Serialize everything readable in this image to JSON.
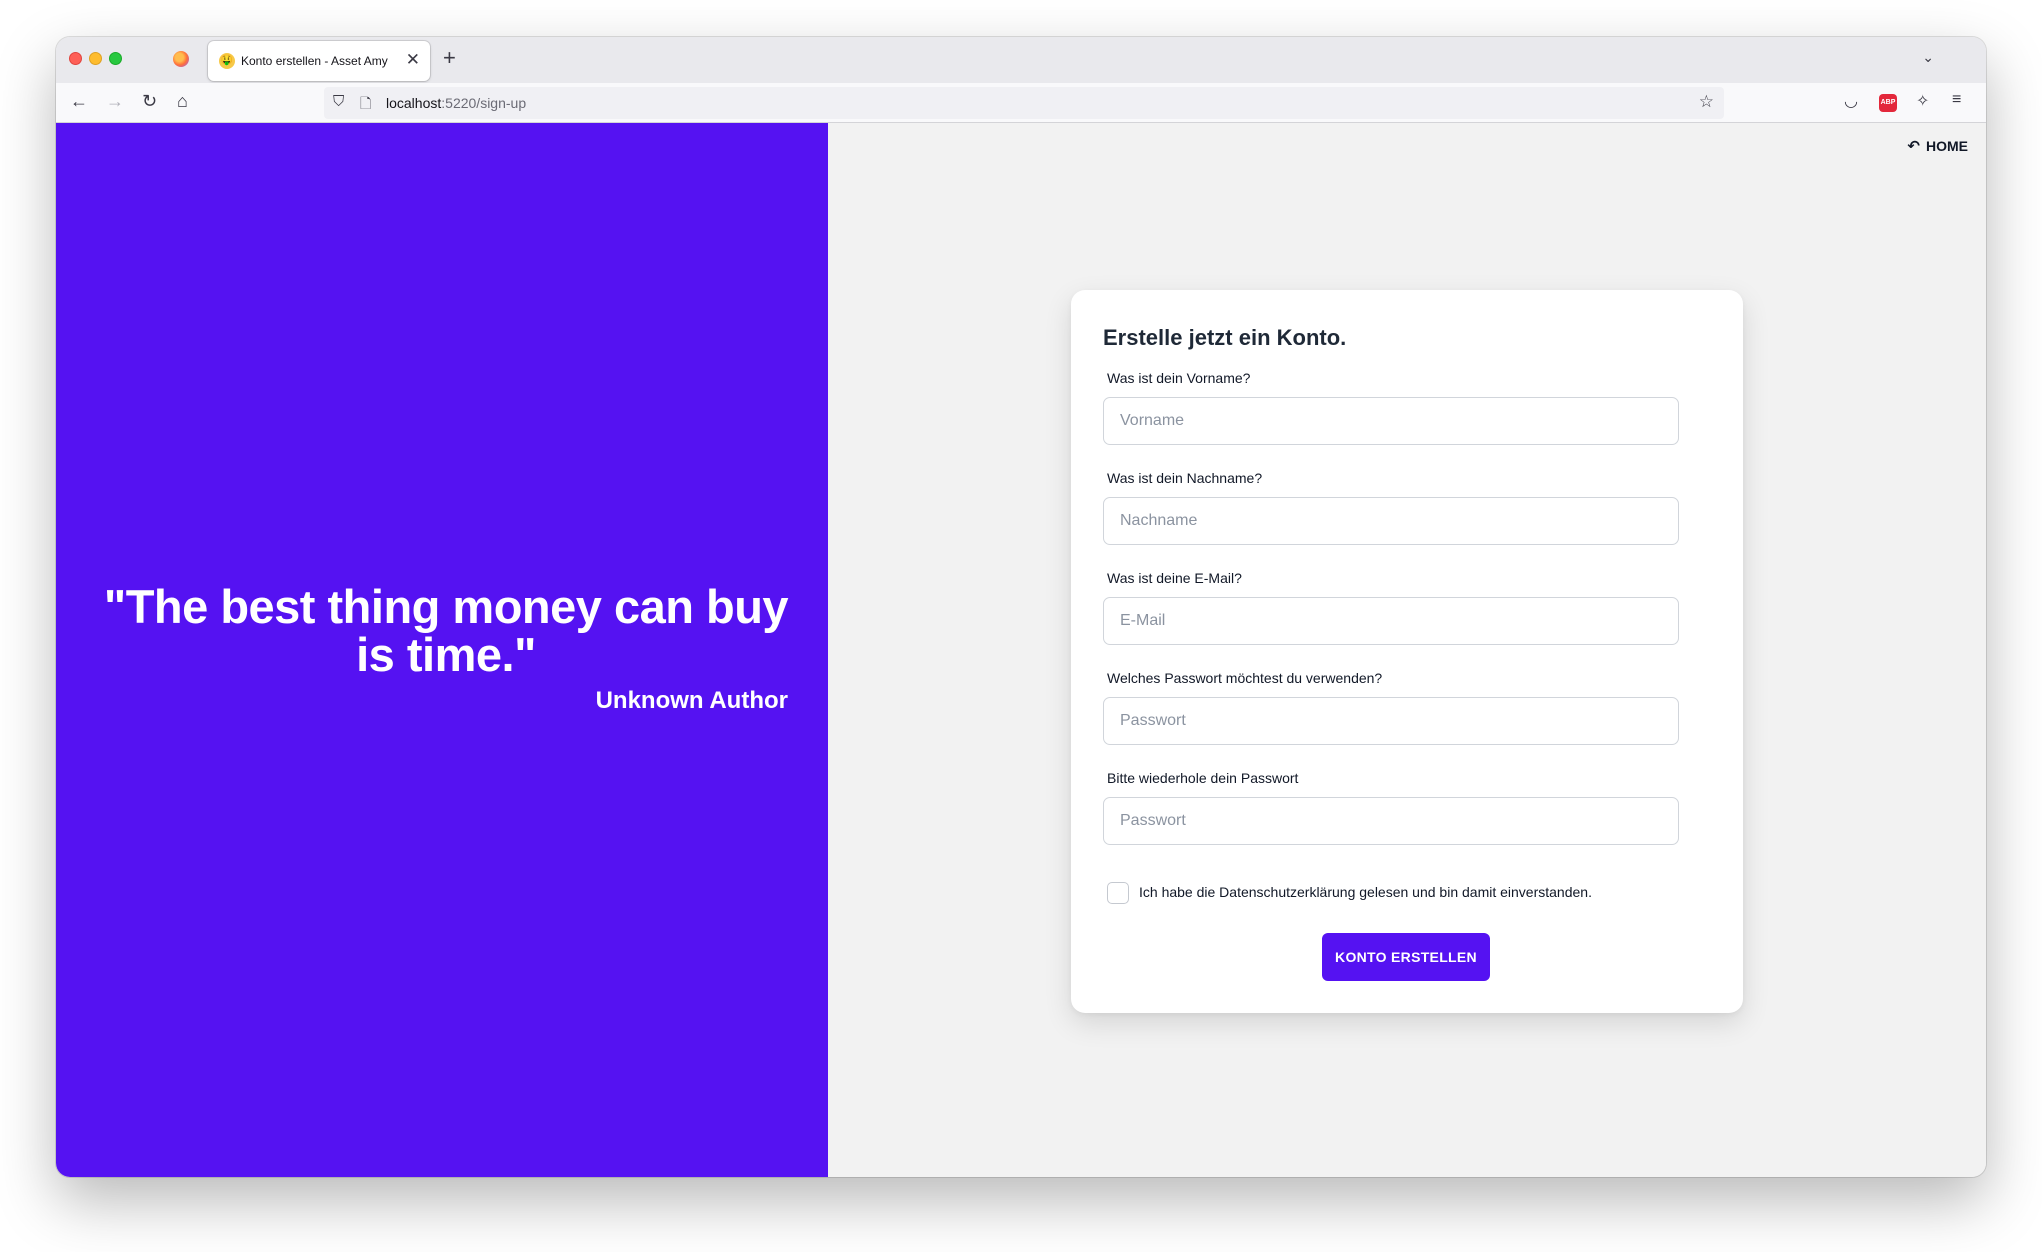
{
  "browser": {
    "tab_title": "Konto erstellen - Asset Amy",
    "tab_favicon": "🤑",
    "new_tab_symbol": "+",
    "close_symbol": "✕",
    "url_host": "localhost",
    "url_rest": ":5220/sign-up"
  },
  "nav": {
    "home_label": "HOME"
  },
  "quote": {
    "text": "\"The best thing money can buy is time.\"",
    "author": "Unknown Author"
  },
  "form": {
    "title": "Erstelle jetzt ein Konto.",
    "firstname": {
      "label": "Was ist dein Vorname?",
      "placeholder": "Vorname"
    },
    "lastname": {
      "label": "Was ist dein Nachname?",
      "placeholder": "Nachname"
    },
    "email": {
      "label": "Was ist deine E-Mail?",
      "placeholder": "E-Mail"
    },
    "password": {
      "label": "Welches Passwort möchtest du verwenden?",
      "placeholder": "Passwort"
    },
    "password_repeat": {
      "label": "Bitte wiederhole dein Passwort",
      "placeholder": "Passwort"
    },
    "privacy_label": "Ich habe die Datenschutzerklärung gelesen und bin damit einverstanden.",
    "submit_label": "KONTO ERSTELLEN"
  },
  "colors": {
    "brand": "#5512f2",
    "page_bg": "#f2f2f2",
    "card_bg": "#ffffff"
  },
  "icons": [
    "firefox-icon",
    "back-arrow-icon",
    "forward-arrow-icon",
    "reload-icon",
    "home-icon",
    "shield-icon",
    "page-icon",
    "star-icon",
    "pocket-icon",
    "adblock-icon",
    "extensions-icon",
    "menu-icon",
    "return-arrow-icon",
    "chevron-down-icon"
  ]
}
